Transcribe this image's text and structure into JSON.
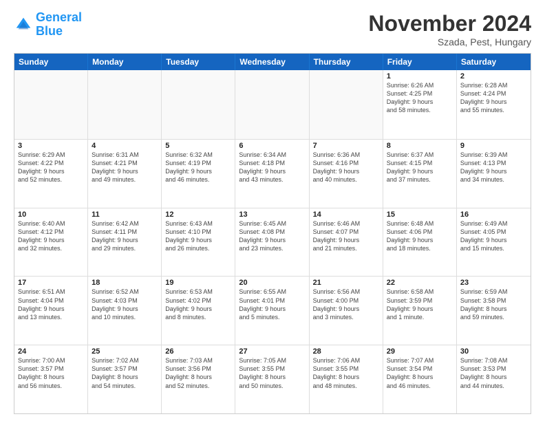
{
  "logo": {
    "line1": "General",
    "line2": "Blue"
  },
  "title": "November 2024",
  "location": "Szada, Pest, Hungary",
  "header": {
    "days": [
      "Sunday",
      "Monday",
      "Tuesday",
      "Wednesday",
      "Thursday",
      "Friday",
      "Saturday"
    ]
  },
  "weeks": [
    {
      "cells": [
        {
          "day": "",
          "info": "",
          "empty": true
        },
        {
          "day": "",
          "info": "",
          "empty": true
        },
        {
          "day": "",
          "info": "",
          "empty": true
        },
        {
          "day": "",
          "info": "",
          "empty": true
        },
        {
          "day": "",
          "info": "",
          "empty": true
        },
        {
          "day": "1",
          "info": "Sunrise: 6:26 AM\nSunset: 4:25 PM\nDaylight: 9 hours\nand 58 minutes.",
          "empty": false
        },
        {
          "day": "2",
          "info": "Sunrise: 6:28 AM\nSunset: 4:24 PM\nDaylight: 9 hours\nand 55 minutes.",
          "empty": false
        }
      ]
    },
    {
      "cells": [
        {
          "day": "3",
          "info": "Sunrise: 6:29 AM\nSunset: 4:22 PM\nDaylight: 9 hours\nand 52 minutes.",
          "empty": false
        },
        {
          "day": "4",
          "info": "Sunrise: 6:31 AM\nSunset: 4:21 PM\nDaylight: 9 hours\nand 49 minutes.",
          "empty": false
        },
        {
          "day": "5",
          "info": "Sunrise: 6:32 AM\nSunset: 4:19 PM\nDaylight: 9 hours\nand 46 minutes.",
          "empty": false
        },
        {
          "day": "6",
          "info": "Sunrise: 6:34 AM\nSunset: 4:18 PM\nDaylight: 9 hours\nand 43 minutes.",
          "empty": false
        },
        {
          "day": "7",
          "info": "Sunrise: 6:36 AM\nSunset: 4:16 PM\nDaylight: 9 hours\nand 40 minutes.",
          "empty": false
        },
        {
          "day": "8",
          "info": "Sunrise: 6:37 AM\nSunset: 4:15 PM\nDaylight: 9 hours\nand 37 minutes.",
          "empty": false
        },
        {
          "day": "9",
          "info": "Sunrise: 6:39 AM\nSunset: 4:13 PM\nDaylight: 9 hours\nand 34 minutes.",
          "empty": false
        }
      ]
    },
    {
      "cells": [
        {
          "day": "10",
          "info": "Sunrise: 6:40 AM\nSunset: 4:12 PM\nDaylight: 9 hours\nand 32 minutes.",
          "empty": false
        },
        {
          "day": "11",
          "info": "Sunrise: 6:42 AM\nSunset: 4:11 PM\nDaylight: 9 hours\nand 29 minutes.",
          "empty": false
        },
        {
          "day": "12",
          "info": "Sunrise: 6:43 AM\nSunset: 4:10 PM\nDaylight: 9 hours\nand 26 minutes.",
          "empty": false
        },
        {
          "day": "13",
          "info": "Sunrise: 6:45 AM\nSunset: 4:08 PM\nDaylight: 9 hours\nand 23 minutes.",
          "empty": false
        },
        {
          "day": "14",
          "info": "Sunrise: 6:46 AM\nSunset: 4:07 PM\nDaylight: 9 hours\nand 21 minutes.",
          "empty": false
        },
        {
          "day": "15",
          "info": "Sunrise: 6:48 AM\nSunset: 4:06 PM\nDaylight: 9 hours\nand 18 minutes.",
          "empty": false
        },
        {
          "day": "16",
          "info": "Sunrise: 6:49 AM\nSunset: 4:05 PM\nDaylight: 9 hours\nand 15 minutes.",
          "empty": false
        }
      ]
    },
    {
      "cells": [
        {
          "day": "17",
          "info": "Sunrise: 6:51 AM\nSunset: 4:04 PM\nDaylight: 9 hours\nand 13 minutes.",
          "empty": false
        },
        {
          "day": "18",
          "info": "Sunrise: 6:52 AM\nSunset: 4:03 PM\nDaylight: 9 hours\nand 10 minutes.",
          "empty": false
        },
        {
          "day": "19",
          "info": "Sunrise: 6:53 AM\nSunset: 4:02 PM\nDaylight: 9 hours\nand 8 minutes.",
          "empty": false
        },
        {
          "day": "20",
          "info": "Sunrise: 6:55 AM\nSunset: 4:01 PM\nDaylight: 9 hours\nand 5 minutes.",
          "empty": false
        },
        {
          "day": "21",
          "info": "Sunrise: 6:56 AM\nSunset: 4:00 PM\nDaylight: 9 hours\nand 3 minutes.",
          "empty": false
        },
        {
          "day": "22",
          "info": "Sunrise: 6:58 AM\nSunset: 3:59 PM\nDaylight: 9 hours\nand 1 minute.",
          "empty": false
        },
        {
          "day": "23",
          "info": "Sunrise: 6:59 AM\nSunset: 3:58 PM\nDaylight: 8 hours\nand 59 minutes.",
          "empty": false
        }
      ]
    },
    {
      "cells": [
        {
          "day": "24",
          "info": "Sunrise: 7:00 AM\nSunset: 3:57 PM\nDaylight: 8 hours\nand 56 minutes.",
          "empty": false
        },
        {
          "day": "25",
          "info": "Sunrise: 7:02 AM\nSunset: 3:57 PM\nDaylight: 8 hours\nand 54 minutes.",
          "empty": false
        },
        {
          "day": "26",
          "info": "Sunrise: 7:03 AM\nSunset: 3:56 PM\nDaylight: 8 hours\nand 52 minutes.",
          "empty": false
        },
        {
          "day": "27",
          "info": "Sunrise: 7:05 AM\nSunset: 3:55 PM\nDaylight: 8 hours\nand 50 minutes.",
          "empty": false
        },
        {
          "day": "28",
          "info": "Sunrise: 7:06 AM\nSunset: 3:55 PM\nDaylight: 8 hours\nand 48 minutes.",
          "empty": false
        },
        {
          "day": "29",
          "info": "Sunrise: 7:07 AM\nSunset: 3:54 PM\nDaylight: 8 hours\nand 46 minutes.",
          "empty": false
        },
        {
          "day": "30",
          "info": "Sunrise: 7:08 AM\nSunset: 3:53 PM\nDaylight: 8 hours\nand 44 minutes.",
          "empty": false
        }
      ]
    }
  ]
}
